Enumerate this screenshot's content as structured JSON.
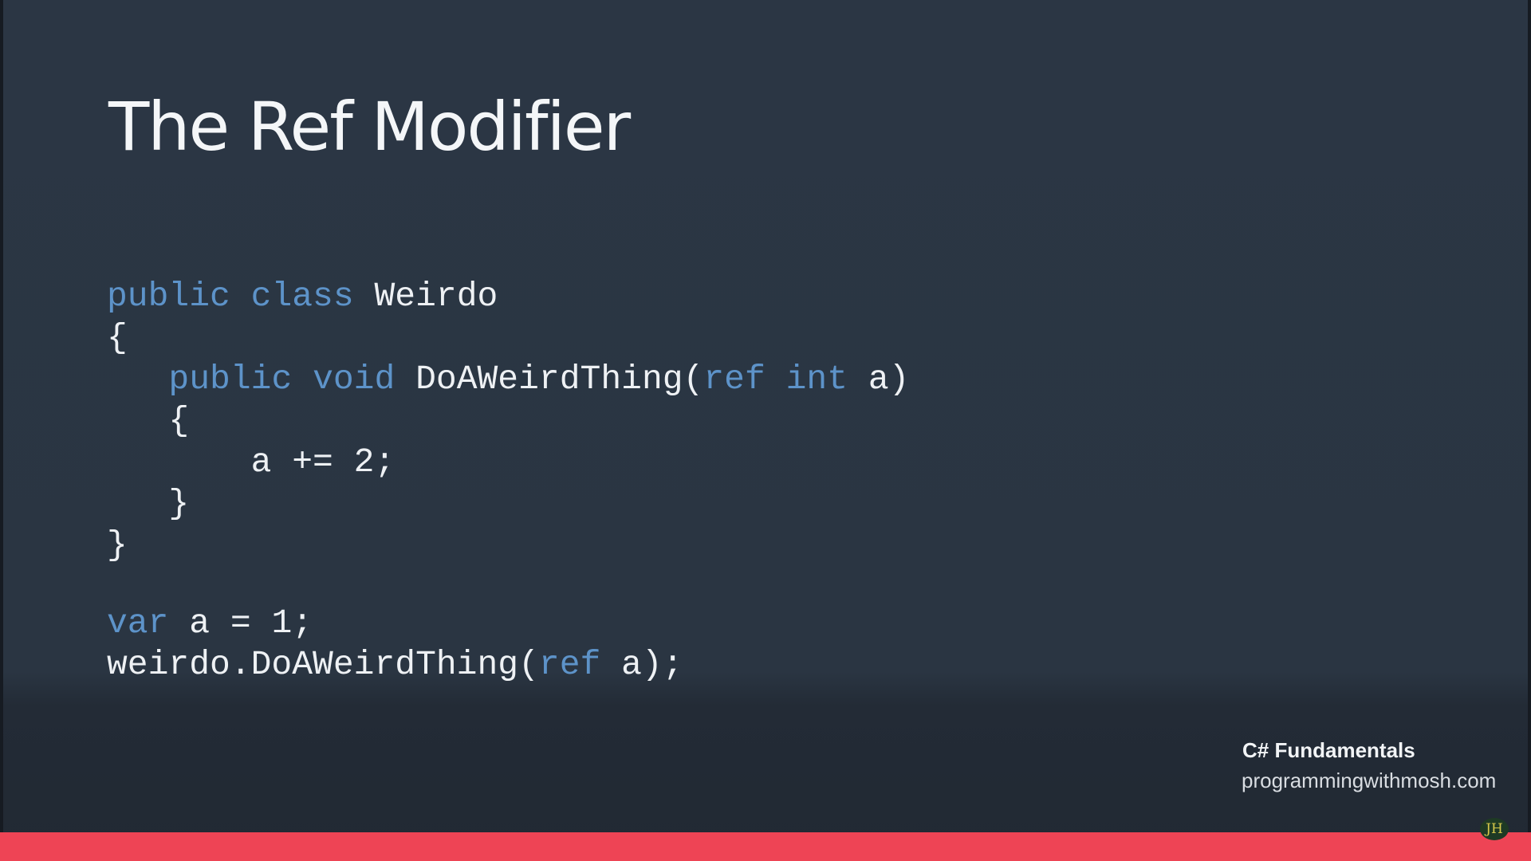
{
  "slide": {
    "title": "The Ref Modifier",
    "code": {
      "line1": {
        "kw1": "public",
        "kw2": "class",
        "name": "Weirdo"
      },
      "line2": "{",
      "line3": {
        "indent": "   ",
        "kw1": "public",
        "kw2": "void",
        "method": "DoAWeirdThing(",
        "kw3": "ref",
        "kw4": "int",
        "tail": "a)"
      },
      "line4": "   {",
      "line5": "       a += 2;",
      "line6": "   }",
      "line7": "}",
      "line8": {
        "kw": "var",
        "rest": "a = 1;"
      },
      "line9": {
        "head": "weirdo.DoAWeirdThing(",
        "kw": "ref",
        "tail": "a);"
      }
    },
    "keyword_color": "#5d93c9",
    "text_color": "#eef1f4",
    "background_color": "#2b3644"
  },
  "footer": {
    "course": "C# Fundamentals",
    "site": "programmingwithmosh.com",
    "bar_color": "#ee4455"
  },
  "watermark": {
    "text": "JH"
  }
}
